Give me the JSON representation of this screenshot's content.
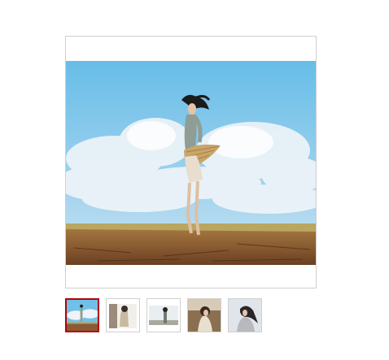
{
  "gallery": {
    "main_image": {
      "subject": "woman-jumping-beach-photo",
      "colors": {
        "sky_top": "#6fc1ea",
        "sky_bottom": "#bfe0f2",
        "cloud": "#e9f2f7",
        "sand": "#8b5a35",
        "grass": "#b8a25c"
      }
    },
    "thumbnails": [
      {
        "id": "thumb-1",
        "selected": true
      },
      {
        "id": "thumb-2",
        "selected": false
      },
      {
        "id": "thumb-3",
        "selected": false
      },
      {
        "id": "thumb-4",
        "selected": false
      },
      {
        "id": "thumb-5",
        "selected": false
      }
    ],
    "selected_color": "#b50000"
  }
}
